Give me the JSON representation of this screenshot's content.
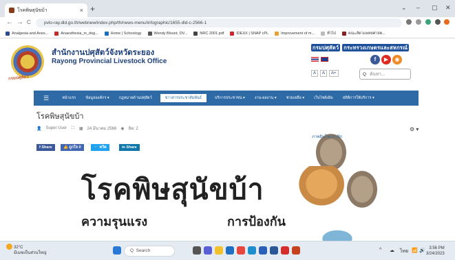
{
  "browser": {
    "tab_title": "โรคพิษสุนัขบ้า",
    "tab_close": "×",
    "new_tab": "+",
    "url": "pvlo-ray.dld.go.th/webnew/index.php/th/news-menu/infographic/1655-dld-c-2566-1",
    "win_min": "⌄",
    "win_restore": "–",
    "win_max": "▢",
    "win_close": "✕",
    "nav_back": "←",
    "nav_forward": "→",
    "nav_reload": "C",
    "bookmarks": [
      {
        "label": "Analgesia and Anes...",
        "color": "#2c4a8f"
      },
      {
        "label": "Anaesthesia_in_dog...",
        "color": "#cc2a2a"
      },
      {
        "label": "Home | Schoology",
        "color": "#1c6fb8"
      },
      {
        "label": "Wendy Blount, DV...",
        "color": "#555555"
      },
      {
        "label": "NRC 2001.pdf",
        "color": "#444444"
      },
      {
        "label": "IDEXX | SNAP cPL",
        "color": "#cc2a2a"
      },
      {
        "label": "Improvement of m...",
        "color": "#e8a232"
      },
      {
        "label": "ทั่วไป",
        "color": "#bbbbbb"
      },
      {
        "label": "คณะสัตวแพทยศาสต...",
        "color": "#8a1f1f"
      }
    ]
  },
  "site": {
    "org_th": "สำนักงานปศุสัตว์จังหวัดระยอง",
    "org_en": "Rayong Provincial Livestock Office",
    "logo_text": "กรมปศุสัตว์",
    "top_links": [
      "กรมปศุสัตว์",
      "กระทรวงเกษตรและสหกรณ์"
    ],
    "font_sizes": [
      "A",
      "A",
      "A+"
    ],
    "search_placeholder": "ค้นหา...",
    "search_icon": "Q",
    "social": [
      {
        "icon": "facebook-icon",
        "glyph": "f",
        "color": "#3b5998"
      },
      {
        "icon": "youtube-icon",
        "glyph": "▶",
        "color": "#e02b20"
      },
      {
        "icon": "rss-icon",
        "glyph": "◉",
        "color": "#f08a24"
      }
    ],
    "nav": [
      {
        "label": "☰",
        "active": false
      },
      {
        "label": "หน้าแรก",
        "active": false
      },
      {
        "label": "ข้อมูลองค์กร ▾",
        "active": false
      },
      {
        "label": "กฎหมายด้านปศุสัตว์",
        "active": false
      },
      {
        "label": "ข่าวสารประชาสัมพันธ์",
        "active": true
      },
      {
        "label": "บริการประชาชน ▾",
        "active": false
      },
      {
        "label": "งาน-ผลงาน ▾",
        "active": false
      },
      {
        "label": "ช่วยเหลือ ▾",
        "active": false
      },
      {
        "label": "เว็บไซต์เดิม",
        "active": false
      },
      {
        "label": "สถิติการให้บริการ ▾",
        "active": false
      }
    ]
  },
  "article": {
    "title": "โรคพิษสุนัขบ้า",
    "author": "Super User",
    "category": "ภาพอินโฟกราฟิก",
    "date": "24 มีนาคม 2566",
    "views": "ฮิต: 2",
    "gear": "⚙ ▾",
    "share_buttons": [
      {
        "label": "f Share",
        "color": "#3b5998"
      },
      {
        "label": "👍 ถูกใจ 0",
        "color": "#4267b2"
      },
      {
        "label": "🐦 ทวีต",
        "color": "#1da1f2"
      },
      {
        "label": "in Share",
        "color": "#0e76a8"
      }
    ],
    "banner_title": "โรคพิษสุนัขบ้า",
    "banner_left": "ความรุนแรง",
    "banner_right": "การป้องกัน"
  },
  "taskbar": {
    "weather_temp": "32°C",
    "weather_desc": "มีเมฆเป็นส่วนใหญ่",
    "search_label": "Search",
    "clock_time": "3:56 PM",
    "clock_date": "3/24/2023",
    "apps": [
      {
        "icon": "start-icon",
        "color": "#2b79d6"
      },
      {
        "icon": "task-view-icon",
        "color": "#555555"
      },
      {
        "icon": "chat-icon",
        "color": "#5a5fd6"
      },
      {
        "icon": "file-explorer-icon",
        "color": "#f2c12e"
      },
      {
        "icon": "mail-icon",
        "color": "#1f6fc2"
      },
      {
        "icon": "chrome-icon",
        "color": "#e8453c"
      },
      {
        "icon": "edge-icon",
        "color": "#1d8fcf"
      },
      {
        "icon": "store-icon",
        "color": "#2b5fb8"
      },
      {
        "icon": "word-icon",
        "color": "#2b5797"
      },
      {
        "icon": "pdf-icon",
        "color": "#d62c2c"
      },
      {
        "icon": "powerpoint-icon",
        "color": "#c6421f"
      }
    ],
    "tray": [
      "^",
      "☁",
      "ไทย",
      "📶",
      "🔊"
    ]
  }
}
